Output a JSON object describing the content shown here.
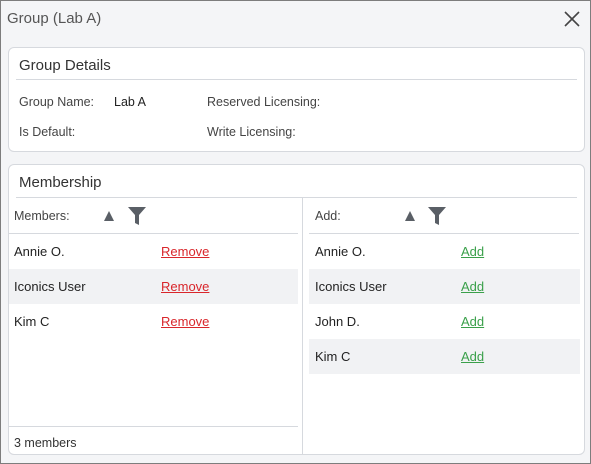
{
  "window": {
    "title": "Group (Lab A)"
  },
  "details": {
    "title": "Group Details",
    "group_name_label": "Group Name:",
    "group_name_value": "Lab A",
    "reserved_licensing_label": "Reserved Licensing:",
    "is_default_label": "Is Default:",
    "write_licensing_label": "Write Licensing:"
  },
  "membership": {
    "title": "Membership",
    "members": {
      "header": "Members:",
      "action_label": "Remove",
      "rows": [
        {
          "name": "Annie O."
        },
        {
          "name": "Iconics User"
        },
        {
          "name": "Kim C"
        }
      ],
      "footer": "3 members"
    },
    "add": {
      "header": "Add:",
      "action_label": "Add",
      "rows": [
        {
          "name": "Annie O."
        },
        {
          "name": "Iconics User"
        },
        {
          "name": "John D."
        },
        {
          "name": "Kim C"
        }
      ]
    }
  },
  "colors": {
    "remove_link": "#d9262b",
    "add_link": "#3aa04a",
    "icon": "#5a5f66"
  },
  "icons": {
    "close": "close-icon",
    "sort": "sort-ascending-icon",
    "filter": "filter-icon"
  }
}
